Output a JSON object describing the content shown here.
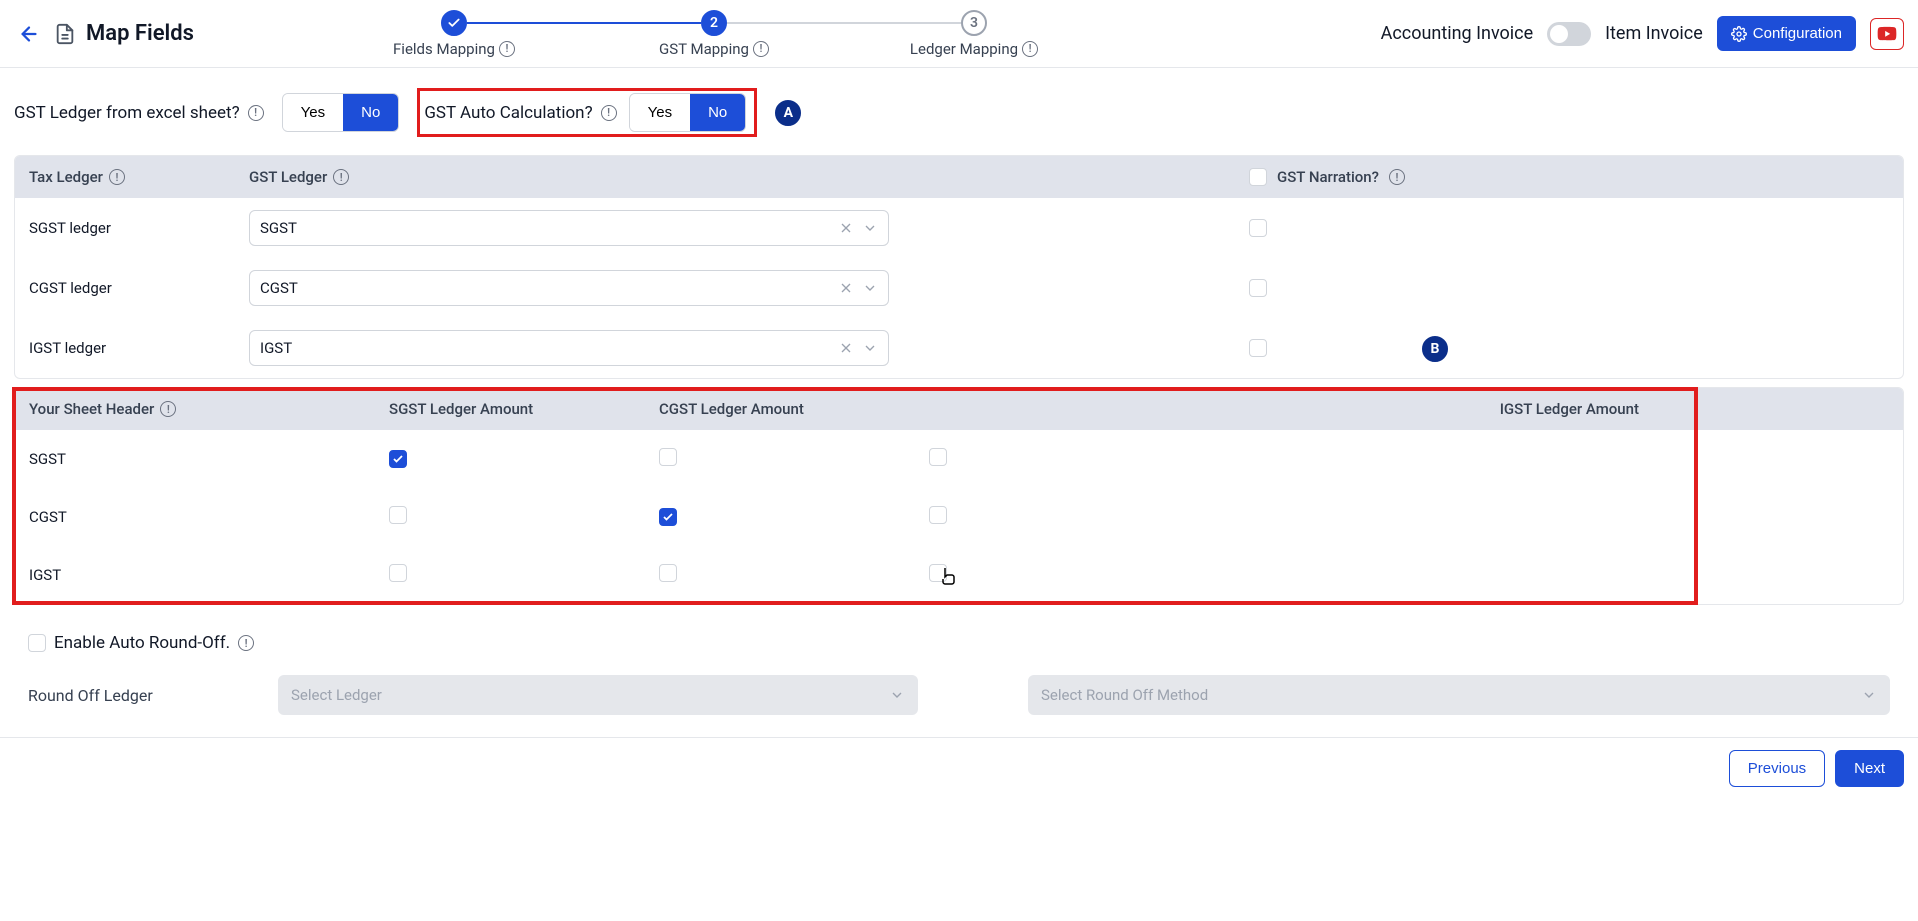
{
  "header": {
    "title": "Map Fields",
    "steps": [
      {
        "label": "Fields Mapping",
        "state": "done"
      },
      {
        "label": "GST Mapping",
        "state": "current",
        "num": "2"
      },
      {
        "label": "Ledger Mapping",
        "state": "future",
        "num": "3"
      }
    ],
    "invoice_left": "Accounting Invoice",
    "invoice_right": "Item Invoice",
    "config_btn": "Configuration"
  },
  "questions": {
    "q1": "GST Ledger from excel sheet?",
    "q2": "GST Auto Calculation?",
    "yes": "Yes",
    "no": "No"
  },
  "annotations": {
    "a": "A",
    "b": "B"
  },
  "tax_table": {
    "h1": "Tax Ledger",
    "h2": "GST Ledger",
    "h3": "GST Narration?",
    "rows": [
      {
        "tax": "SGST ledger",
        "gst": "SGST"
      },
      {
        "tax": "CGST ledger",
        "gst": "CGST"
      },
      {
        "tax": "IGST ledger",
        "gst": "IGST"
      }
    ]
  },
  "sheet_table": {
    "h1": "Your Sheet Header",
    "h2": "SGST Ledger Amount",
    "h3": "CGST Ledger Amount",
    "h4": "IGST Ledger Amount",
    "rows": [
      {
        "name": "SGST",
        "sgst": true,
        "cgst": false,
        "igst": false
      },
      {
        "name": "CGST",
        "sgst": false,
        "cgst": true,
        "igst": false
      },
      {
        "name": "IGST",
        "sgst": false,
        "cgst": false,
        "igst": false
      }
    ]
  },
  "roundoff": {
    "enable_label": "Enable Auto Round-Off.",
    "ledger_label": "Round Off Ledger",
    "select_ledger_ph": "Select Ledger",
    "select_method_ph": "Select Round Off Method"
  },
  "footer": {
    "prev": "Previous",
    "next": "Next"
  }
}
